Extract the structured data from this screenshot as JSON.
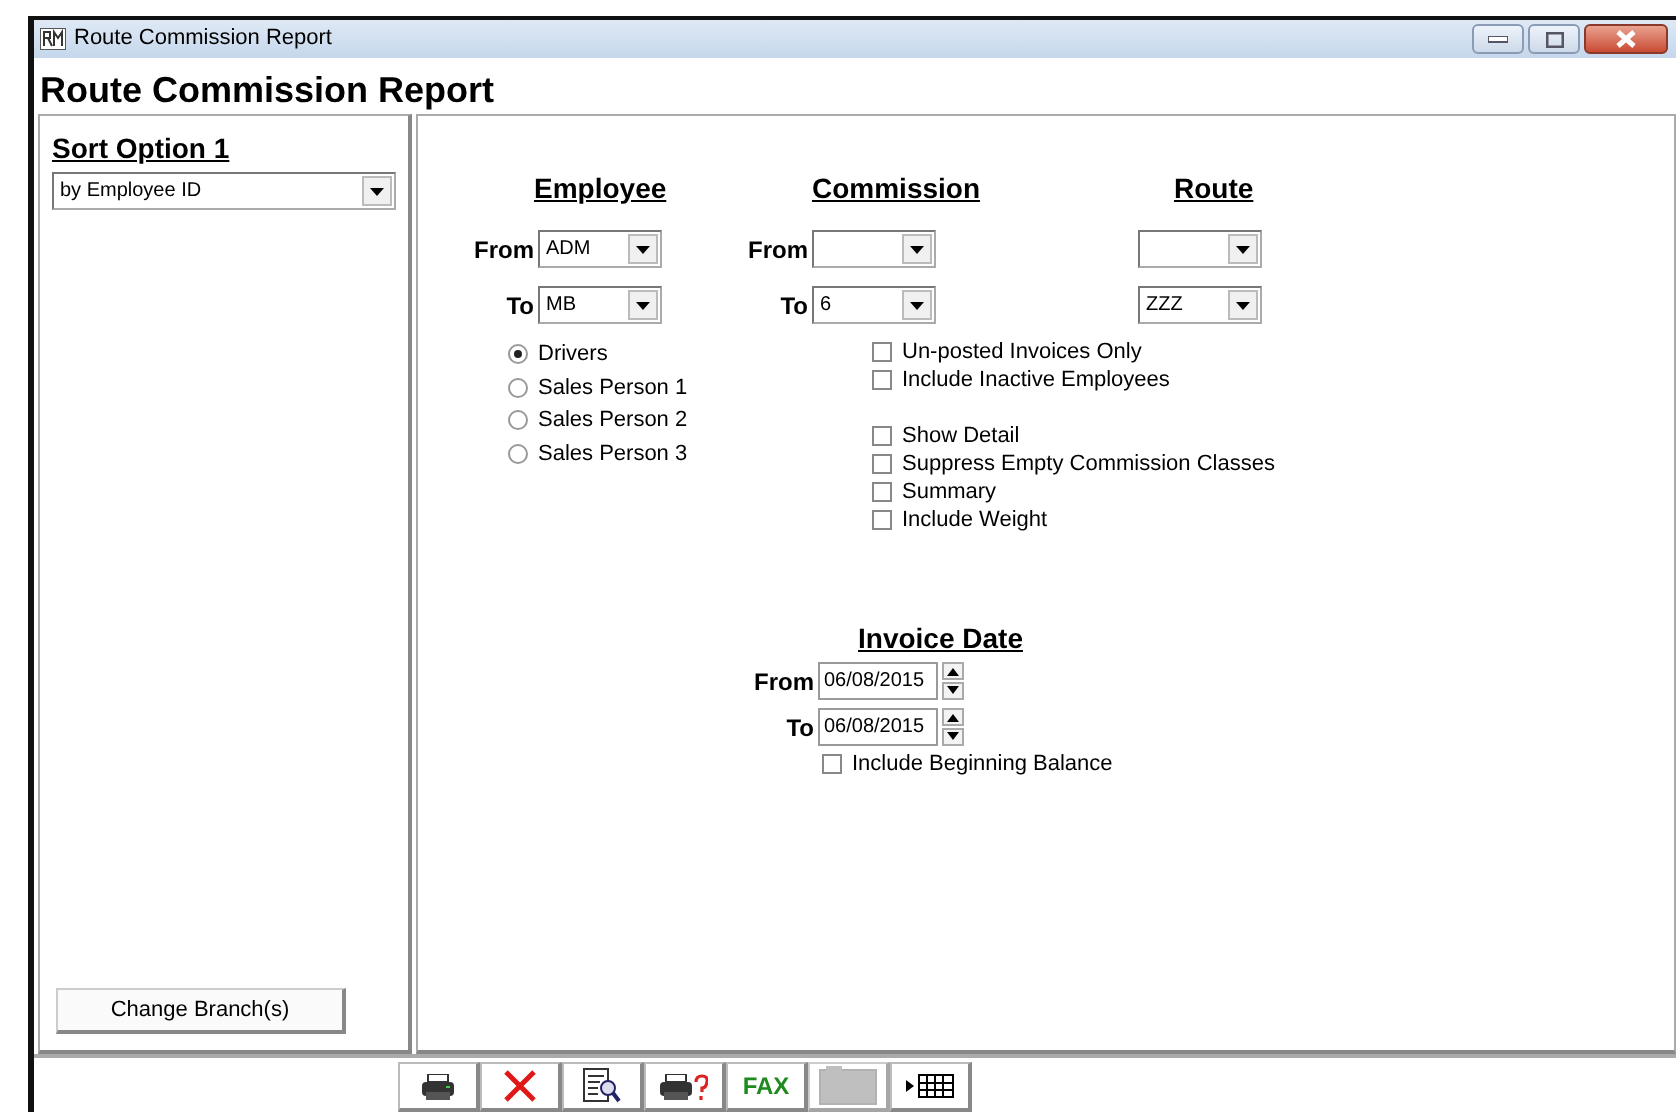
{
  "window": {
    "title": "Route Commission Report"
  },
  "header": {
    "title": "Route Commission Report"
  },
  "sort_option": {
    "label": "Sort Option 1",
    "value": "by Employee ID"
  },
  "change_branch_button": "Change Branch(s)",
  "employee": {
    "heading": "Employee",
    "from": {
      "label": "From",
      "value": "ADM"
    },
    "to": {
      "label": "To",
      "value": "MB"
    },
    "radios": [
      {
        "label": "Drivers",
        "selected": true
      },
      {
        "label": "Sales Person 1",
        "selected": false
      },
      {
        "label": "Sales Person 2",
        "selected": false
      },
      {
        "label": "Sales Person 3",
        "selected": false
      }
    ]
  },
  "commission": {
    "heading": "Commission",
    "from": {
      "label": "From"
    },
    "to": {
      "label": "To",
      "value": "6"
    },
    "option_groups": [
      [
        {
          "label": "Un-posted Invoices Only",
          "checked": false
        },
        {
          "label": "Include Inactive Employees",
          "checked": false
        }
      ],
      [
        {
          "label": "Show Detail",
          "checked": false
        },
        {
          "label": "Suppress Empty Commission Classes",
          "checked": false
        },
        {
          "label": "Summary",
          "checked": false
        },
        {
          "label": "Include Weight",
          "checked": false
        }
      ]
    ]
  },
  "route": {
    "heading": "Route",
    "to": {
      "value": "ZZZ"
    }
  },
  "invoice_date": {
    "heading": "Invoice Date",
    "from": {
      "label": "From",
      "value": "06/08/2015"
    },
    "to": {
      "label": "To",
      "value": "06/08/2015"
    },
    "include_beginning_balance": {
      "label": "Include Beginning Balance",
      "checked": false
    }
  },
  "toolbar": [
    {
      "kind": "print",
      "disabled": false
    },
    {
      "kind": "cancel",
      "disabled": false
    },
    {
      "kind": "preview",
      "disabled": false
    },
    {
      "kind": "print-setup",
      "disabled": false
    },
    {
      "kind": "fax",
      "text": "FAX",
      "disabled": false
    },
    {
      "kind": "export",
      "disabled": true
    },
    {
      "kind": "grid",
      "disabled": false
    }
  ]
}
